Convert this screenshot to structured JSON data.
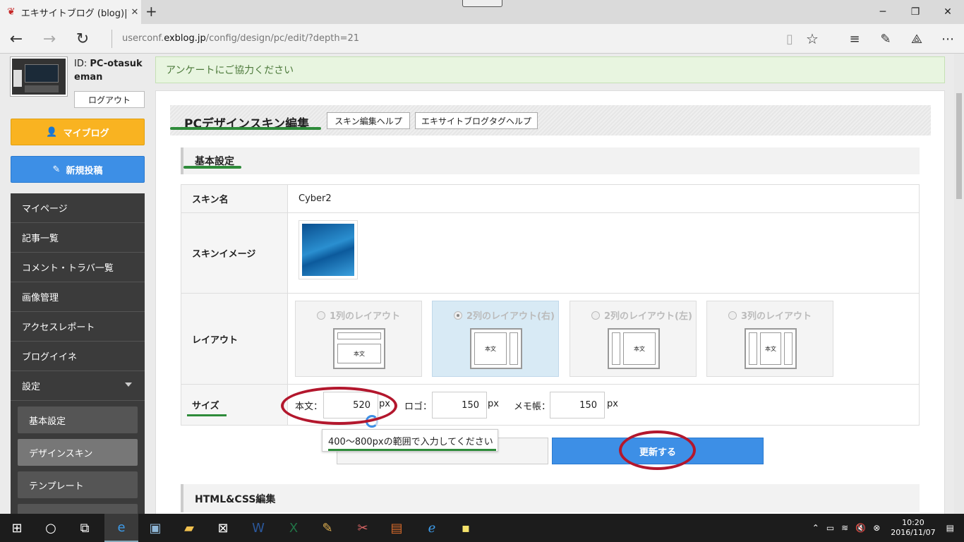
{
  "browser": {
    "tab_title": "エキサイトブログ (blog)|マイ",
    "url_prefix": "userconf.",
    "url_domain": "exblog.jp",
    "url_path": "/config/design/pc/edit/?depth=21"
  },
  "sidebar": {
    "user_id_label": "ID:",
    "user_id": "PC-otasukeman",
    "logout": "ログアウト",
    "myblog": "マイブログ",
    "newpost": "新規投稿",
    "menu": [
      "マイページ",
      "記事一覧",
      "コメント・トラバ一覧",
      "画像管理",
      "アクセスレポート",
      "ブログイイネ",
      "設定"
    ],
    "submenu": [
      "基本設定",
      "デザインスキン",
      "テンプレート"
    ]
  },
  "notice": "アンケートにご協力ください",
  "header": {
    "title": "PCデザインスキン編集",
    "help1": "スキン編集ヘルプ",
    "help2": "エキサイトブログタグヘルプ"
  },
  "section": {
    "title": "基本設定"
  },
  "table": {
    "skin_name_label": "スキン名",
    "skin_name": "Cyber2",
    "skin_image_label": "スキンイメージ",
    "layout_label": "レイアウト",
    "size_label": "サイズ"
  },
  "layouts": [
    {
      "label": "1列のレイアウト",
      "body": "本文"
    },
    {
      "label": "2列のレイアウト(右)",
      "body": "本文",
      "selected": true
    },
    {
      "label": "2列のレイアウト(左)",
      "body": "本文"
    },
    {
      "label": "3列のレイアウト",
      "body": "本文"
    }
  ],
  "size": {
    "body_label": "本文：",
    "body_value": "520",
    "logo_label": "ロゴ：",
    "logo_value": "150",
    "memo_label": "メモ帳：",
    "memo_value": "150",
    "unit": "px"
  },
  "tooltip": "400～800pxの範囲で入力してください",
  "update_button": "更新する",
  "section2": {
    "title": "HTML&CSS編集"
  },
  "taskbar": {
    "time": "10:20",
    "date": "2016/11/07"
  }
}
